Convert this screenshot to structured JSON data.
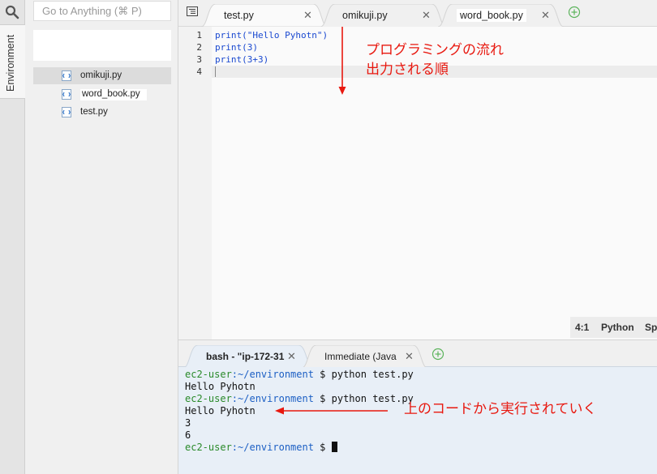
{
  "sidebar": {
    "env_tab_label": "Environment",
    "goto_placeholder": "Go to Anything (⌘ P)",
    "files": [
      {
        "name": "omikuji.py"
      },
      {
        "name": "word_book.py"
      },
      {
        "name": "test.py"
      }
    ]
  },
  "editor_tabs": [
    {
      "label": "test.py"
    },
    {
      "label": "omikuji.py"
    },
    {
      "label": "word_book.py"
    }
  ],
  "editor": {
    "line_numbers": [
      "1",
      "2",
      "3",
      "4"
    ],
    "lines": [
      "print(\"Hello Pyhotn\")",
      "print(3)",
      "print(3+3)",
      ""
    ],
    "annotation_line1": "プログラミングの流れ",
    "annotation_line2": "出力される順"
  },
  "status": {
    "position": "4:1",
    "language": "Python",
    "spaces": "Spa"
  },
  "terminal_tabs": [
    {
      "label": "bash - \"ip-172-31"
    },
    {
      "label": "Immediate (Java"
    }
  ],
  "terminal": {
    "user": "ec2-user",
    "path": ":~/environment",
    "command": " $ python test.py",
    "prompt_end": " $ ",
    "output1": "Hello Pyhotn",
    "output2": "Hello Pyhotn",
    "output3": "3",
    "output4": "6",
    "annotation": "上のコードから実行されていく"
  },
  "colors": {
    "annotation": "#e8180f",
    "prompt_user": "#2a8a2a",
    "prompt_path": "#1c5fc4",
    "code": "#1a49d0"
  }
}
